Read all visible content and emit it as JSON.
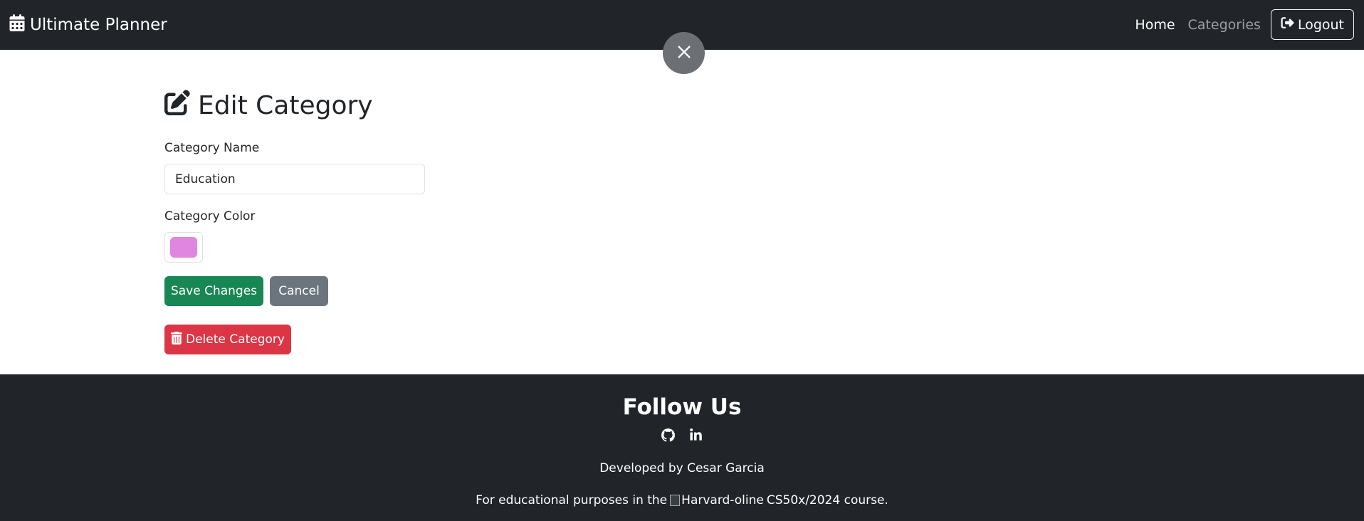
{
  "navbar": {
    "brand": "Ultimate Planner",
    "links": {
      "home": "Home",
      "categories": "Categories"
    },
    "logout": "Logout"
  },
  "page": {
    "title": "Edit Category",
    "name_label": "Category Name",
    "name_value": "Education",
    "color_label": "Category Color",
    "color_value": "#e086e0",
    "save_label": "Save Changes",
    "cancel_label": "Cancel",
    "delete_label": "Delete Category"
  },
  "footer": {
    "title": "Follow Us",
    "developed_by": "Developed by Cesar Garcia",
    "edu_prefix": "For educational purposes in the",
    "edu_img_alt": "Harvard-oline",
    "edu_suffix": "CS50x/2024 course."
  },
  "colors": {
    "navbar_bg": "#212529",
    "save": "#198754",
    "cancel": "#6c757d",
    "delete": "#dc3545"
  },
  "icons": [
    "calendar-icon",
    "logout-icon",
    "close-icon",
    "edit-icon",
    "trash-icon",
    "github-icon",
    "linkedin-icon"
  ]
}
